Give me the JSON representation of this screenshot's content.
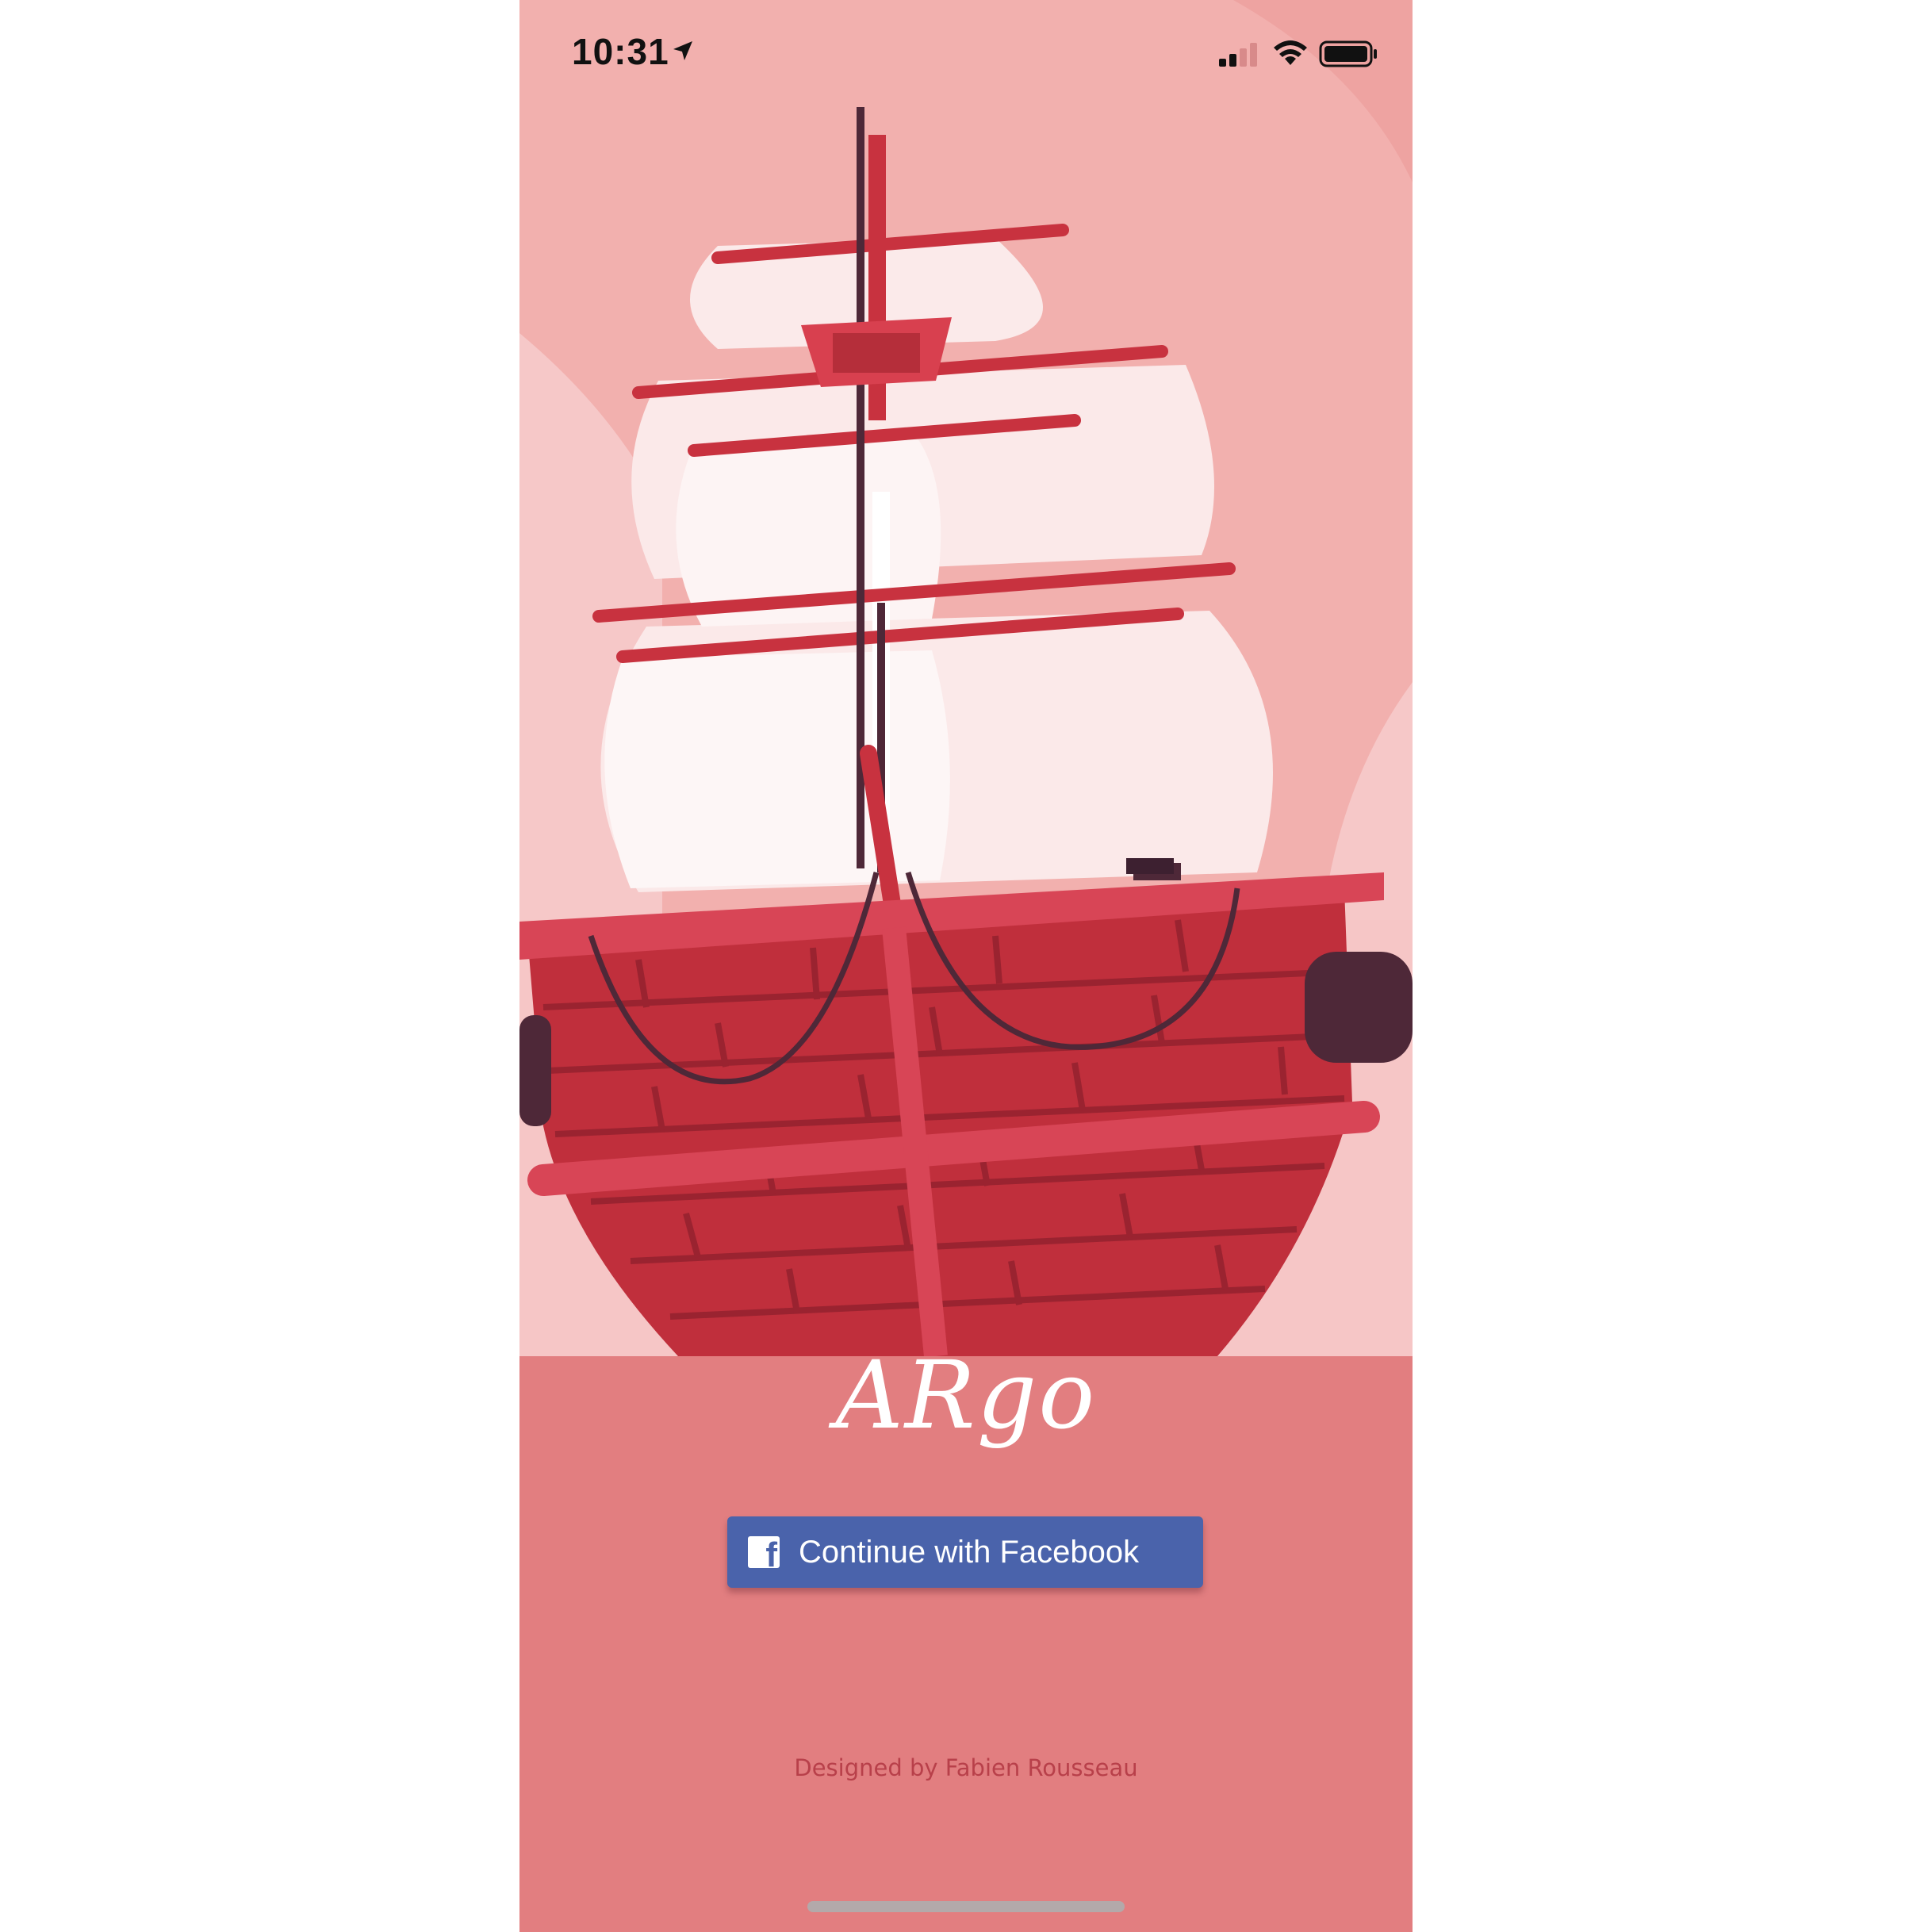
{
  "status_bar": {
    "time": "10:31",
    "icons": [
      "location-arrow-icon",
      "cellular-signal-icon",
      "wifi-icon",
      "battery-icon"
    ]
  },
  "app": {
    "logo_text": "ARgo",
    "illustration": "pirate-ship"
  },
  "login": {
    "facebook_button_label": "Continue with Facebook",
    "facebook_icon_glyph": "f"
  },
  "footer": {
    "credit": "Designed by Fabien Rousseau"
  },
  "colors": {
    "sky": "#f2b0ae",
    "sea": "#e27e80",
    "hull": "#c02f3c",
    "hull_trim": "#d84556",
    "sail": "#fbeceb",
    "facebook_blue": "#4a63ab",
    "credit_text": "#b8404a"
  }
}
